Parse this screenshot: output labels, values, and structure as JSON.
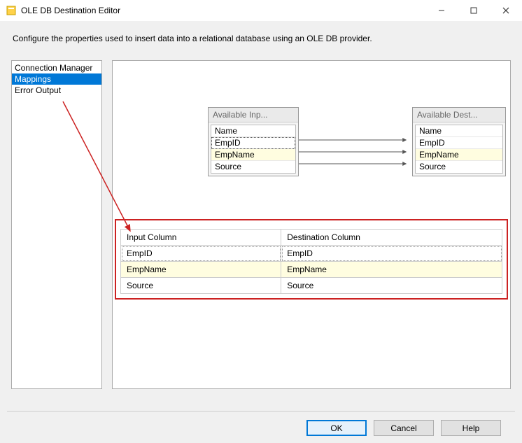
{
  "window": {
    "title": "OLE DB Destination Editor",
    "description": "Configure the properties used to insert data into a relational database using an OLE DB provider."
  },
  "sidebar": {
    "items": [
      {
        "label": "Connection Manager",
        "selected": false
      },
      {
        "label": "Mappings",
        "selected": true
      },
      {
        "label": "Error Output",
        "selected": false
      }
    ]
  },
  "mapping": {
    "input_header": "Available Inp...",
    "dest_header": "Available Dest...",
    "input_columns": [
      "Name",
      "EmpID",
      "EmpName",
      "Source"
    ],
    "dest_columns": [
      "Name",
      "EmpID",
      "EmpName",
      "Source"
    ]
  },
  "grid": {
    "headers": {
      "input": "Input Column",
      "dest": "Destination Column"
    },
    "rows": [
      {
        "input": "EmpID",
        "dest": "EmpID",
        "dotted": true
      },
      {
        "input": "EmpName",
        "dest": "EmpName",
        "highlight": true
      },
      {
        "input": "Source",
        "dest": "Source"
      }
    ]
  },
  "buttons": {
    "ok": "OK",
    "cancel": "Cancel",
    "help": "Help"
  }
}
